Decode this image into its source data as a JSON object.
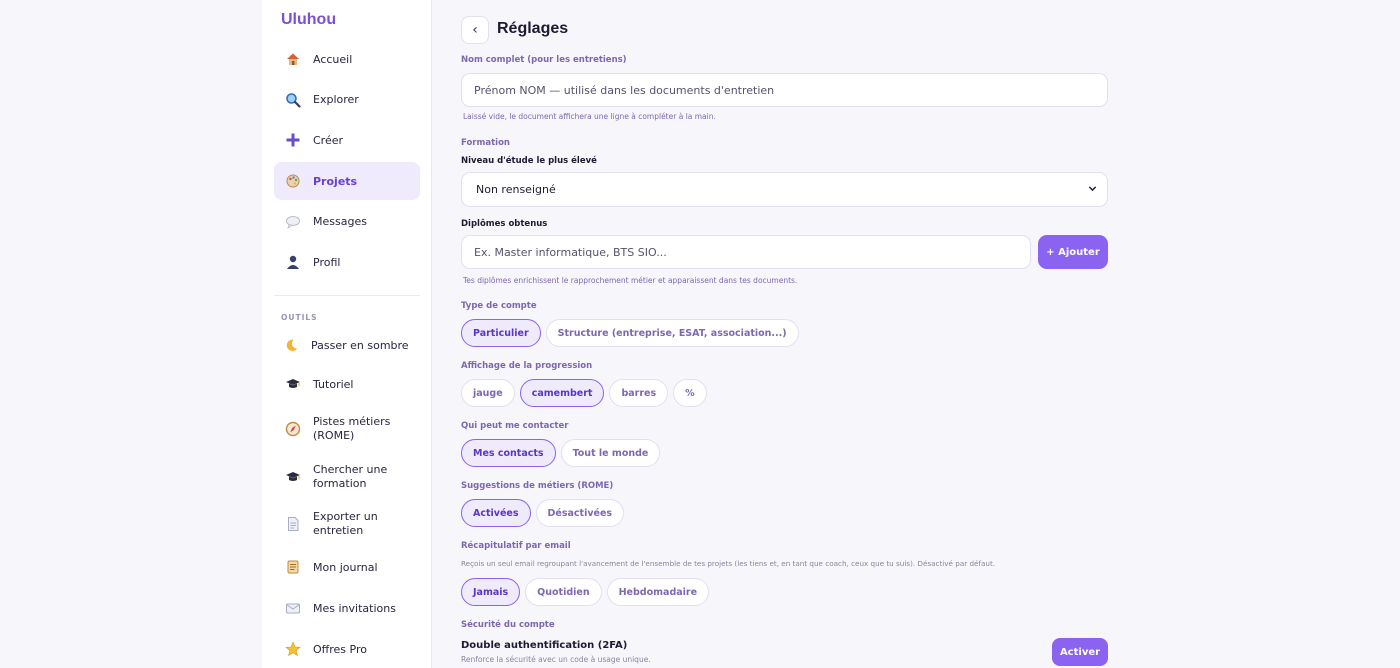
{
  "app": {
    "brand": "Uluhou"
  },
  "sidebar": {
    "items": [
      {
        "label": "Accueil",
        "icon": "house-icon",
        "active": false
      },
      {
        "label": "Explorer",
        "icon": "magnifier-icon",
        "active": false
      },
      {
        "label": "Créer",
        "icon": "plus-icon",
        "active": false
      },
      {
        "label": "Projets",
        "icon": "palette-icon",
        "active": true
      },
      {
        "label": "Messages",
        "icon": "speech-bubble-icon",
        "active": false
      },
      {
        "label": "Profil",
        "icon": "user-icon",
        "active": false
      }
    ],
    "tools_label": "OUTILS",
    "tools": [
      {
        "label": "Passer en sombre",
        "icon": "moon-icon"
      },
      {
        "label": "Tutoriel",
        "icon": "graduation-cap-icon"
      },
      {
        "label_line1": "Pistes métiers",
        "label_line2": "(ROME)",
        "icon": "compass-icon"
      },
      {
        "label_line1": "Chercher une",
        "label_line2": "formation",
        "icon": "graduation-cap-icon"
      },
      {
        "label_line1": "Exporter un",
        "label_line2": "entretien",
        "icon": "document-icon"
      },
      {
        "label": "Mon journal",
        "icon": "scroll-icon"
      },
      {
        "label": "Mes invitations",
        "icon": "envelope-icon"
      },
      {
        "label": "Offres Pro",
        "icon": "star-icon"
      }
    ]
  },
  "page": {
    "back_glyph": "‹",
    "title": "Réglages",
    "full_name": {
      "label": "Nom complet (pour les entretiens)",
      "placeholder": "Prénom NOM — utilisé dans les documents d'entretien",
      "hint": "Laissé vide, le document affichera une ligne à compléter à la main."
    },
    "formation": {
      "section_label": "Formation",
      "level_label": "Niveau d'étude le plus élevé",
      "level_value": "Non renseigné",
      "diplomas_label": "Diplômes obtenus",
      "diplomas_placeholder": "Ex. Master informatique, BTS SIO...",
      "add_button": "+ Ajouter",
      "diplomas_hint": "Tes diplômes enrichissent le rapprochement métier et apparaissent dans tes documents."
    },
    "account_type": {
      "label": "Type de compte",
      "options": [
        "Particulier",
        "Structure (entreprise, ESAT, association...)"
      ],
      "selected": "Particulier"
    },
    "progress_display": {
      "label": "Affichage de la progression",
      "options": [
        "jauge",
        "camembert",
        "barres",
        "%"
      ],
      "selected": "camembert"
    },
    "contact": {
      "label": "Qui peut me contacter",
      "options": [
        "Mes contacts",
        "Tout le monde"
      ],
      "selected": "Mes contacts"
    },
    "suggestions": {
      "label": "Suggestions de métiers (ROME)",
      "options": [
        "Activées",
        "Désactivées"
      ],
      "selected": "Activées"
    },
    "email_recap": {
      "label": "Récapitulatif par email",
      "description": "Reçois un seul email regroupant l'avancement de l'ensemble de tes projets (les tiens et, en tant que coach, ceux que tu suis). Désactivé par défaut.",
      "options": [
        "Jamais",
        "Quotidien",
        "Hebdomadaire"
      ],
      "selected": "Jamais"
    },
    "security": {
      "label": "Sécurité du compte",
      "twofa_title": "Double authentification (2FA)",
      "twofa_desc": "Renforce la sécurité avec un code à usage unique.",
      "activate_button": "Activer"
    }
  },
  "colors": {
    "accent": "#8a63f0",
    "active_bg": "#efeafc",
    "label_purple": "#7d68b0"
  }
}
